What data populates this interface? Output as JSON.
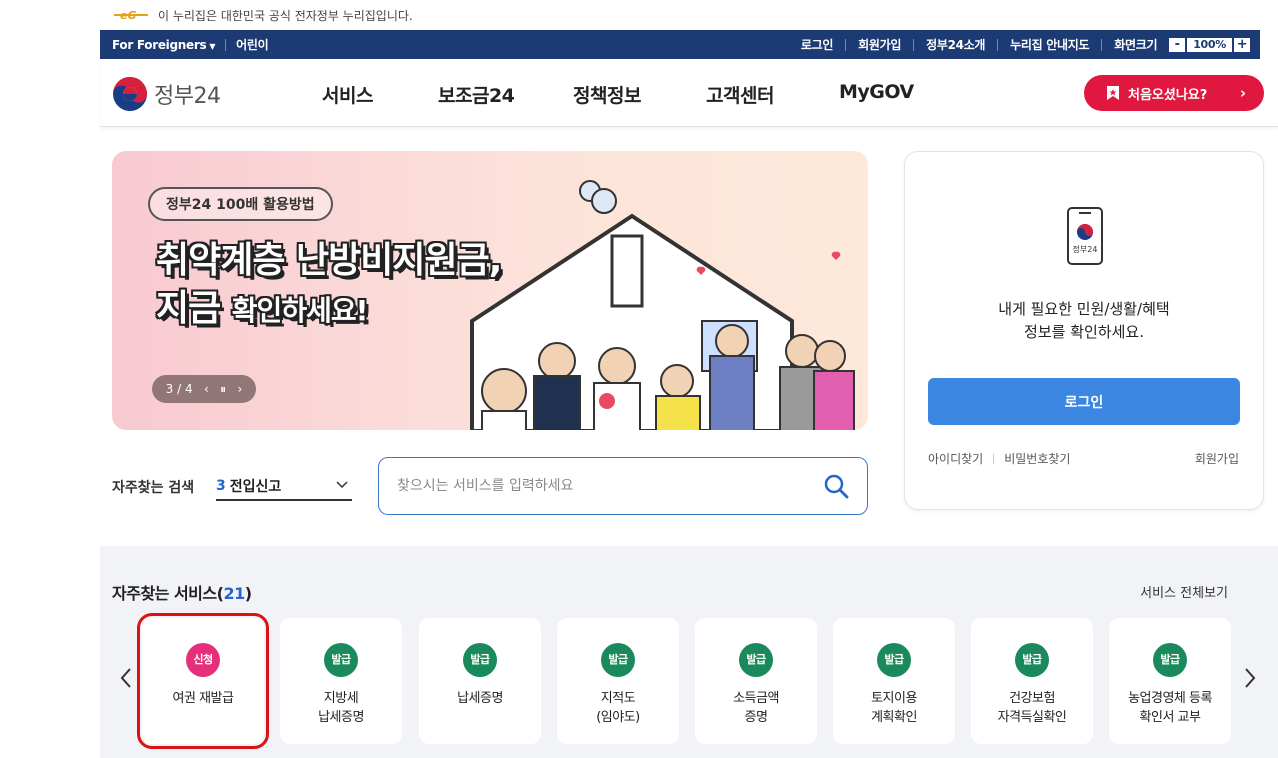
{
  "gov_banner": {
    "text": "이 누리집은 대한민국 공식 전자정부 누리집입니다."
  },
  "util_bar": {
    "left": [
      "For Foreigners",
      "어린이"
    ],
    "right": [
      "로그인",
      "회원가입",
      "정부24소개",
      "누리집 안내지도",
      "화면크기"
    ],
    "zoom_minus": "-",
    "zoom_value": "100%",
    "zoom_plus": "+"
  },
  "header": {
    "logo_text": "정부24",
    "nav": [
      "서비스",
      "보조금24",
      "정책정보",
      "고객센터",
      "MyGOV"
    ],
    "first_visit": "처음오셨나요?"
  },
  "hero": {
    "chip": "정부24 100배 활용방법",
    "title_line1": "취약계층 난방비지원금,",
    "title_line2_big": "지금",
    "title_line2_small": "확인하세요!",
    "pager": "3 / 4",
    "prev": "‹",
    "pause": "⏸",
    "next": "›"
  },
  "frequent_search": {
    "label": "자주찾는 검색",
    "selected_rank": "3",
    "selected_text": "전입신고"
  },
  "search": {
    "placeholder": "찾으시는 서비스를 입력하세요"
  },
  "login_card": {
    "phone_label": "정부24",
    "message_line1": "내게 필요한 민원/생활/혜택",
    "message_line2": "정보를 확인하세요.",
    "login_button": "로그인",
    "find_id": "아이디찾기",
    "find_pw": "비밀번호찾기",
    "signup": "회원가입"
  },
  "services": {
    "title": "자주찾는 서비스",
    "count": "21",
    "view_all": "서비스 전체보기",
    "items": [
      {
        "tag": "신청",
        "line1": "여권 재발급",
        "line2": ""
      },
      {
        "tag": "발급",
        "line1": "지방세",
        "line2": "납세증명"
      },
      {
        "tag": "발급",
        "line1": "납세증명",
        "line2": ""
      },
      {
        "tag": "발급",
        "line1": "지적도",
        "line2": "(임야도)"
      },
      {
        "tag": "발급",
        "line1": "소득금액",
        "line2": "증명"
      },
      {
        "tag": "발급",
        "line1": "토지이용",
        "line2": "계획확인"
      },
      {
        "tag": "발급",
        "line1": "건강보험",
        "line2": "자격득실확인"
      },
      {
        "tag": "발급",
        "line1": "농업경영체 등록",
        "line2": "확인서 교부"
      }
    ]
  },
  "colors": {
    "util_bar_bg": "#1c3a73",
    "accent_blue": "#3a86e0",
    "first_visit_red": "#e0173e",
    "tag_green": "#1a8a5c",
    "tag_pink": "#e62f7a",
    "highlight_red": "#dd1111"
  },
  "icons": {
    "search": "search-icon",
    "chevron_down": "chevron-down-icon",
    "bookmark": "bookmark-icon",
    "phone": "mobile-phone-icon"
  }
}
